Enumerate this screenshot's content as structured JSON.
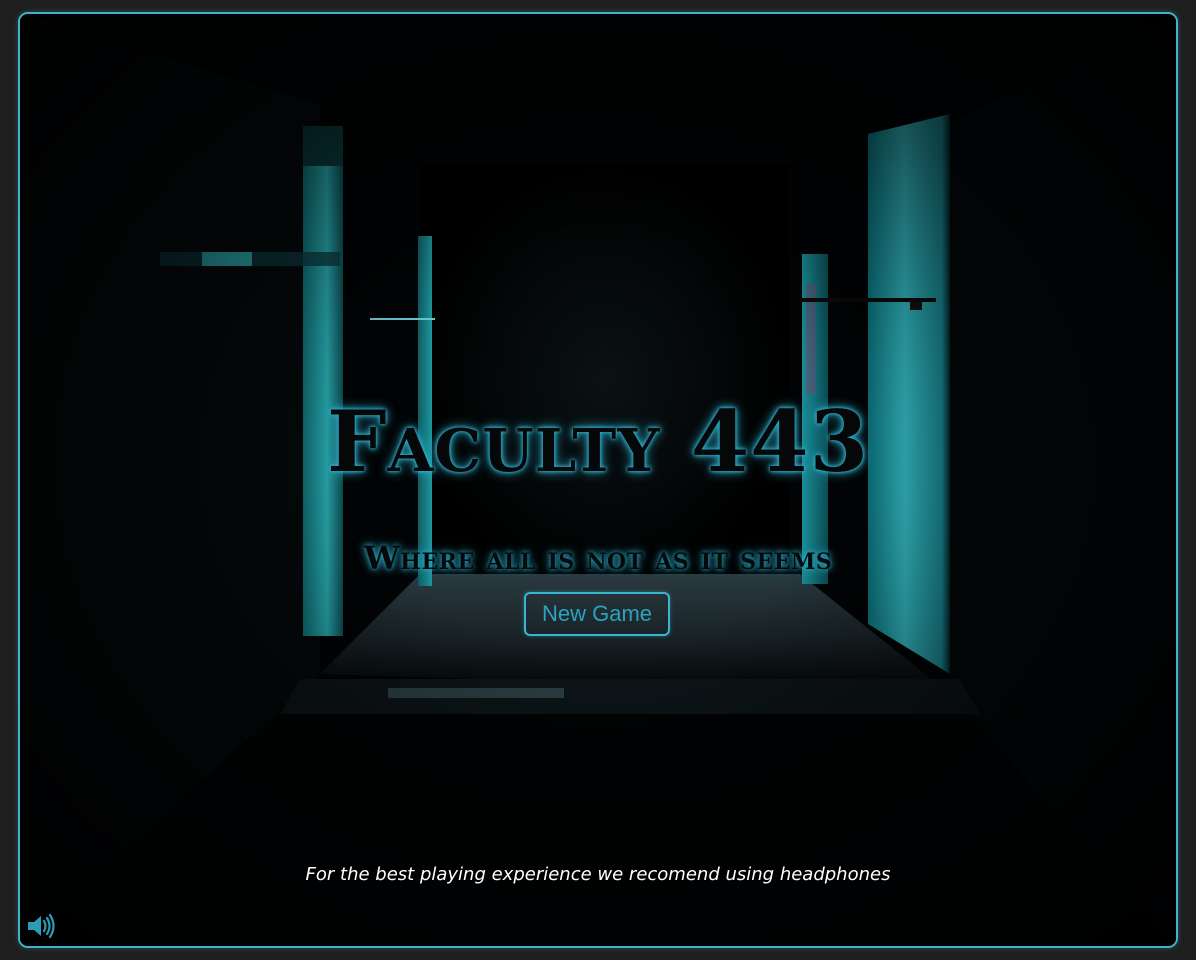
{
  "game": {
    "title": "Faculty 443",
    "tagline": "Where all is not as it seems",
    "new_game_label": "New Game",
    "headphones_tip": "For the best playing experience we recomend using headphones"
  },
  "controls": {
    "sound_icon": "speaker-volume-icon"
  },
  "colors": {
    "accent": "#3fb3c8",
    "title_glow": "#2aa7c4",
    "button_text": "#2ba3bd",
    "background": "#010406"
  }
}
